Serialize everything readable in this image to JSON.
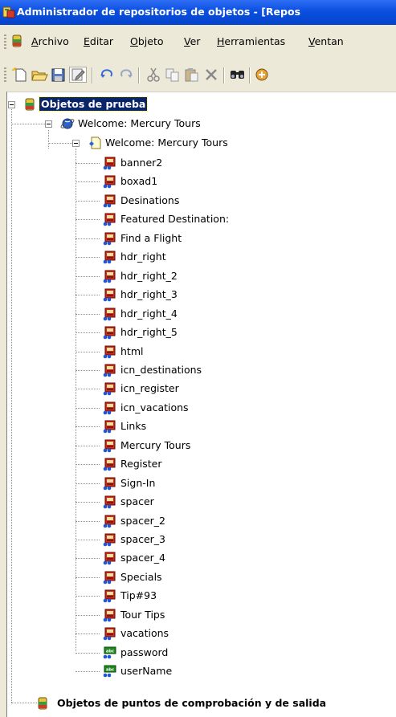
{
  "window": {
    "title": "Administrador de repositorios de objetos - [Repos"
  },
  "menu": [
    {
      "key": "A",
      "rest": "rchivo"
    },
    {
      "key": "E",
      "rest": "ditar"
    },
    {
      "key": "O",
      "rest": "bjeto"
    },
    {
      "key": "V",
      "rest": "er"
    },
    {
      "key": "H",
      "rest": "erramientas"
    },
    {
      "key": "V",
      "rest": "entan"
    }
  ],
  "toolbar_icons": [
    "new-icon",
    "open-folder-icon",
    "save-icon",
    "edit-icon",
    "undo-icon",
    "redo-icon",
    "cut-icon",
    "copy-icon",
    "paste-icon",
    "delete-icon",
    "find-icon",
    "add-objects-icon"
  ],
  "tree": {
    "root": {
      "label": "Objetos de prueba",
      "selected": true
    },
    "browser": {
      "label": "Welcome: Mercury Tours"
    },
    "page": {
      "label": "Welcome: Mercury Tours"
    },
    "objects": [
      {
        "label": "banner2",
        "type": "image"
      },
      {
        "label": "boxad1",
        "type": "image"
      },
      {
        "label": "Desinations",
        "type": "image"
      },
      {
        "label": "Featured Destination:",
        "type": "image"
      },
      {
        "label": "Find a Flight",
        "type": "image"
      },
      {
        "label": "hdr_right",
        "type": "image"
      },
      {
        "label": "hdr_right_2",
        "type": "image"
      },
      {
        "label": "hdr_right_3",
        "type": "image"
      },
      {
        "label": "hdr_right_4",
        "type": "image"
      },
      {
        "label": "hdr_right_5",
        "type": "image"
      },
      {
        "label": "html",
        "type": "image"
      },
      {
        "label": "icn_destinations",
        "type": "image"
      },
      {
        "label": "icn_register",
        "type": "image"
      },
      {
        "label": "icn_vacations",
        "type": "image"
      },
      {
        "label": "Links",
        "type": "image"
      },
      {
        "label": "Mercury Tours",
        "type": "image"
      },
      {
        "label": "Register",
        "type": "image"
      },
      {
        "label": "Sign-In",
        "type": "image"
      },
      {
        "label": "spacer",
        "type": "image"
      },
      {
        "label": "spacer_2",
        "type": "image"
      },
      {
        "label": "spacer_3",
        "type": "image"
      },
      {
        "label": "spacer_4",
        "type": "image"
      },
      {
        "label": "Specials",
        "type": "image"
      },
      {
        "label": "Tip#93",
        "type": "image"
      },
      {
        "label": "Tour Tips",
        "type": "image"
      },
      {
        "label": "vacations",
        "type": "image"
      },
      {
        "label": "password",
        "type": "edit"
      },
      {
        "label": "userName",
        "type": "edit"
      }
    ],
    "checkpoints": {
      "label": "Objetos de puntos de comprobación y de salida"
    }
  },
  "colors": {
    "titlebar": "#0a4fe0",
    "chrome": "#ece9d8",
    "selection": "#0a246a"
  }
}
